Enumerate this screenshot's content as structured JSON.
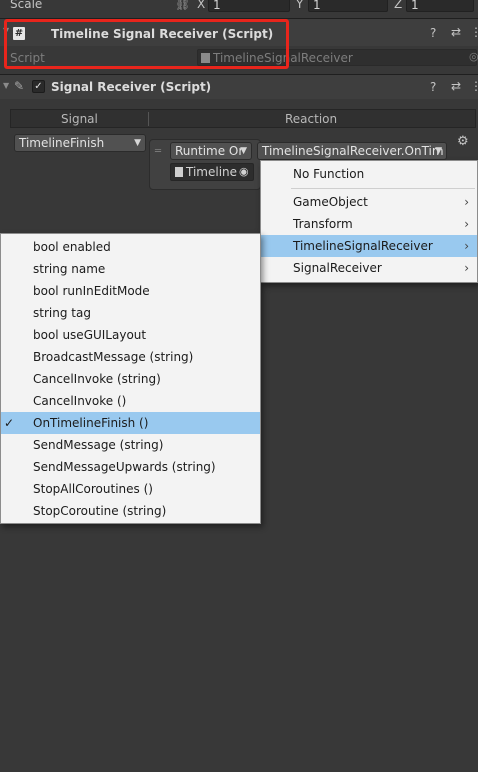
{
  "transform_scale": {
    "label": "Scale",
    "x_label": "X",
    "x_value": "1",
    "y_label": "Y",
    "y_value": "1",
    "z_label": "Z",
    "z_value": "1"
  },
  "timeline_signal_receiver": {
    "title": "Timeline Signal Receiver (Script)",
    "script_label": "Script",
    "script_value": "TimelineSignalReceiver"
  },
  "signal_receiver": {
    "title": "Signal Receiver (Script)",
    "column_signal": "Signal",
    "column_reaction": "Reaction",
    "signal_value": "TimelineFinish",
    "runtime_mode": "Runtime Or",
    "function_value": "TimelineSignalReceiver.OnTim",
    "object_value": "Timeline"
  },
  "component_menu": {
    "no_function": "No Function",
    "items": [
      "GameObject",
      "Transform",
      "TimelineSignalReceiver",
      "SignalReceiver"
    ],
    "selected": "TimelineSignalReceiver"
  },
  "method_menu": {
    "items": [
      "bool enabled",
      "string name",
      "bool runInEditMode",
      "string tag",
      "bool useGUILayout",
      "BroadcastMessage (string)",
      "CancelInvoke (string)",
      "CancelInvoke ()",
      "OnTimelineFinish ()",
      "SendMessage (string)",
      "SendMessageUpwards (string)",
      "StopAllCoroutines ()",
      "StopCoroutine (string)"
    ],
    "checked": "OnTimelineFinish ()"
  },
  "colors": {
    "highlight_box": "#e8251c",
    "menu_selection": "#99c9ef",
    "inspector_bg": "#383838"
  }
}
